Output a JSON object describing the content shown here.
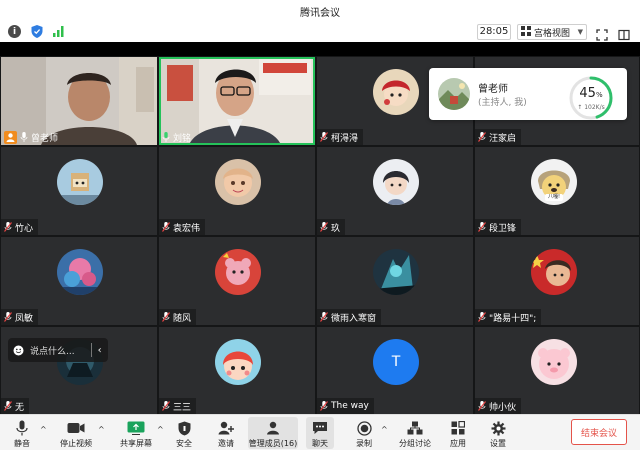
{
  "window": {
    "title": "腾讯会议"
  },
  "topbar": {
    "timer": "28:05",
    "view_label": "宫格视图"
  },
  "host_card": {
    "name": "曾老师",
    "role": "(主持人, 我)",
    "percent_value": 45,
    "percent_text": "45",
    "percent_unit": "%",
    "speed": "↑ 102K/s"
  },
  "participants": [
    {
      "name": "曾老师",
      "host": true
    },
    {
      "name": "刘铭",
      "active": true
    },
    {
      "name": "柯淂淂"
    },
    {
      "name": "汪家启"
    },
    {
      "name": "竹心"
    },
    {
      "name": "袁宏伟"
    },
    {
      "name": "玖"
    },
    {
      "name": "段卫锋"
    },
    {
      "name": "凤敏"
    },
    {
      "name": "随风"
    },
    {
      "name": "微雨入寒窗"
    },
    {
      "name": "\"路易十四\";"
    },
    {
      "name": "无"
    },
    {
      "name": "三三"
    },
    {
      "name": "The way"
    },
    {
      "name": "帅小伙"
    }
  ],
  "avatar_letter": "T",
  "dog_caption": "八嘎!",
  "chat": {
    "placeholder": "说点什么..."
  },
  "toolbar": {
    "mute": "静音",
    "stop_video": "停止视频",
    "share": "共享屏幕",
    "security": "安全",
    "invite": "邀请",
    "members": "管理成员(16)",
    "chat": "聊天",
    "record": "录制",
    "breakout": "分组讨论",
    "apps": "应用",
    "settings": "设置",
    "end": "结束会议"
  },
  "colors": {
    "ring": "#2fbf6b",
    "end": "#e4534a",
    "share_icon": "#1aa35c"
  }
}
